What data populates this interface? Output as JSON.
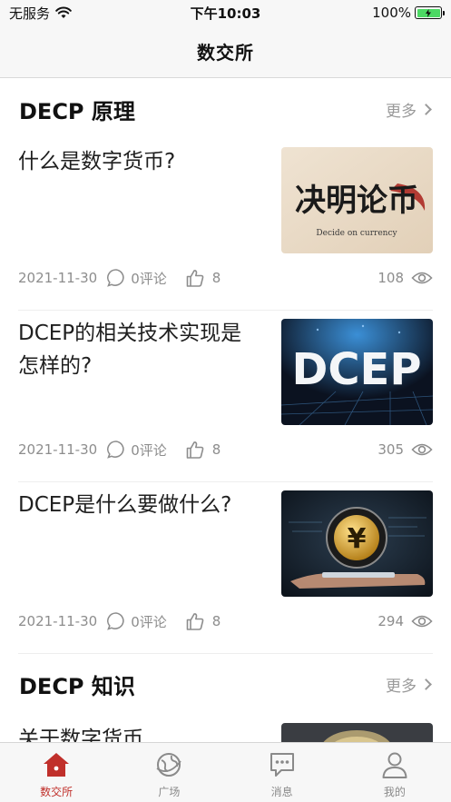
{
  "status_bar": {
    "carrier": "无服务",
    "time": "下午10:03",
    "battery": "100%",
    "battery_level": 1.0
  },
  "nav": {
    "title": "数交所"
  },
  "sections": [
    {
      "title": "DECP 原理",
      "more_label": "更多",
      "articles": [
        {
          "title": "什么是数字货币?",
          "date": "2021-11-30",
          "comments": "0评论",
          "likes": "8",
          "views": "108",
          "thumb_caption": "Decide on currency",
          "thumb_text": "决明论币"
        },
        {
          "title": "DCEP的相关技术实现是怎样的?",
          "date": "2021-11-30",
          "comments": "0评论",
          "likes": "8",
          "views": "305",
          "thumb_text": "DCEP"
        },
        {
          "title": "DCEP是什么要做什么?",
          "date": "2021-11-30",
          "comments": "0评论",
          "likes": "8",
          "views": "294",
          "thumb_text": "¥"
        }
      ]
    },
    {
      "title": "DECP 知识",
      "more_label": "更多",
      "articles": [
        {
          "title": "关于数字货币"
        }
      ]
    }
  ],
  "tabs": [
    {
      "label": "数交所",
      "icon": "home-icon",
      "active": true
    },
    {
      "label": "广场",
      "icon": "globe-icon",
      "active": false
    },
    {
      "label": "消息",
      "icon": "chat-icon",
      "active": false
    },
    {
      "label": "我的",
      "icon": "user-icon",
      "active": false
    }
  ],
  "colors": {
    "accent": "#c0302b",
    "muted": "#8d8d8d",
    "battery_green": "#4cd964"
  }
}
